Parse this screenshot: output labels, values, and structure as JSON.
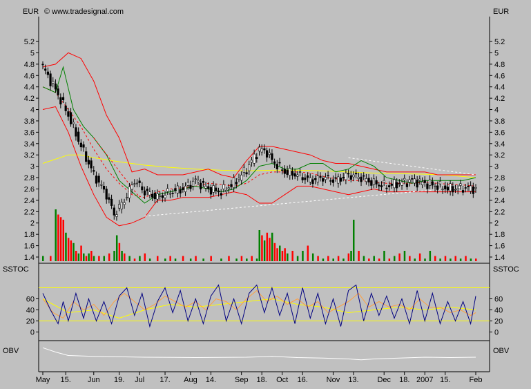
{
  "header": {
    "left_currency": "EUR",
    "copyright": "© www.tradesignal.com",
    "right_currency": "EUR"
  },
  "panel_labels": {
    "sstoc_left": "SSTOC",
    "sstoc_right": "SSTOC",
    "obv_left": "OBV",
    "obv_right": "OBV"
  },
  "colors": {
    "background": "#c0c0c0",
    "candle": "#000000",
    "bollinger_bands": "#ff0000",
    "bollinger_mid": "#ff0000",
    "green_ma": "#008000",
    "yellow_ma": "#ffff00",
    "trendline": "#ffffff",
    "volume_up": "#008000",
    "volume_down": "#ff0000",
    "stoch_k": "#000080",
    "stoch_d": "#ffa040",
    "stoch_signal": "#ffff00",
    "stoch_levels": "#ffff00",
    "obv_line": "#ffffff"
  },
  "chart_data": {
    "type": "line",
    "price_axis": {
      "ticks": [
        1.4,
        1.6,
        1.8,
        2,
        2.2,
        2.4,
        2.6,
        2.8,
        3,
        3.2,
        3.4,
        3.6,
        3.8,
        4,
        4.2,
        4.4,
        4.6,
        4.8,
        5,
        5.2
      ],
      "labels": [
        "1.4",
        "1.6",
        "1.8",
        "2",
        "2.2",
        "2.4",
        "2.6",
        "2.8",
        "3",
        "3.2",
        "3.4",
        "3.6",
        "3.8",
        "4",
        "4.2",
        "4.4",
        "4.6",
        "4.8",
        "5",
        "5.2"
      ]
    },
    "sstoc_axis": {
      "ticks": [
        0,
        20,
        40,
        60
      ],
      "labels": [
        "0",
        "20",
        "40",
        "60"
      ]
    },
    "x_axis": {
      "labels": [
        "May",
        "15.",
        "Jun",
        "19.",
        "Jul",
        "17.",
        "Aug",
        "14.",
        "Sep",
        "18.",
        "Oct",
        "16.",
        "Nov",
        "13.",
        "Dec",
        "18.",
        "2007",
        "15.",
        "Feb"
      ],
      "index": [
        0,
        9,
        20,
        30,
        38,
        48,
        58,
        66,
        78,
        86,
        94,
        102,
        114,
        122,
        134,
        142,
        150,
        158,
        170
      ]
    },
    "series": [
      {
        "key": "close",
        "index": [
          0,
          5,
          10,
          15,
          20,
          25,
          28,
          32,
          36,
          40,
          45,
          50,
          55,
          60,
          65,
          70,
          75,
          80,
          85,
          88,
          90,
          95,
          100,
          105,
          110,
          115,
          120,
          125,
          130,
          135,
          140,
          145,
          150,
          155,
          160,
          165,
          170
        ],
        "values": [
          4.75,
          4.35,
          3.9,
          3.35,
          2.85,
          2.5,
          2.15,
          2.4,
          2.75,
          2.55,
          2.45,
          2.55,
          2.6,
          2.75,
          2.6,
          2.55,
          2.7,
          2.95,
          3.3,
          3.25,
          3.1,
          2.9,
          2.85,
          2.75,
          2.8,
          2.75,
          2.85,
          2.8,
          2.7,
          2.65,
          2.7,
          2.75,
          2.7,
          2.65,
          2.6,
          2.62,
          2.6
        ]
      },
      {
        "key": "bollinger_upper",
        "index": [
          0,
          5,
          10,
          15,
          20,
          25,
          30,
          35,
          40,
          45,
          50,
          55,
          60,
          65,
          70,
          75,
          80,
          85,
          90,
          95,
          100,
          105,
          110,
          115,
          120,
          125,
          130,
          135,
          140,
          145,
          150,
          155,
          160,
          165,
          170
        ],
        "values": [
          4.75,
          4.8,
          5.0,
          4.9,
          4.5,
          3.9,
          3.5,
          2.9,
          2.95,
          2.85,
          2.85,
          2.85,
          2.9,
          2.95,
          2.85,
          2.8,
          3.1,
          3.35,
          3.35,
          3.3,
          3.25,
          3.2,
          3.1,
          3.05,
          3.05,
          3.0,
          2.95,
          2.9,
          2.9,
          2.9,
          2.9,
          2.85,
          2.85,
          2.85,
          2.85
        ]
      },
      {
        "key": "bollinger_lower",
        "index": [
          0,
          5,
          10,
          15,
          20,
          25,
          30,
          35,
          40,
          45,
          50,
          55,
          60,
          65,
          70,
          75,
          80,
          85,
          90,
          95,
          100,
          105,
          110,
          115,
          120,
          125,
          130,
          135,
          140,
          145,
          150,
          155,
          160,
          165,
          170
        ],
        "values": [
          4.0,
          4.05,
          3.6,
          3.0,
          2.5,
          2.1,
          1.95,
          2.0,
          2.1,
          2.4,
          2.4,
          2.45,
          2.45,
          2.45,
          2.5,
          2.55,
          2.5,
          2.35,
          2.35,
          2.5,
          2.65,
          2.65,
          2.6,
          2.55,
          2.5,
          2.55,
          2.6,
          2.55,
          2.55,
          2.55,
          2.55,
          2.55,
          2.55,
          2.55,
          2.55
        ]
      },
      {
        "key": "bollinger_middle",
        "index": [
          0,
          5,
          10,
          15,
          20,
          25,
          30,
          35,
          40,
          45,
          50,
          55,
          60,
          65,
          70,
          75,
          80,
          85,
          90,
          95,
          100,
          105,
          110,
          115,
          120,
          125,
          130,
          135,
          140,
          145,
          150,
          155,
          160,
          165,
          170
        ],
        "values": [
          4.4,
          4.3,
          4.0,
          3.7,
          3.3,
          2.95,
          2.7,
          2.5,
          2.45,
          2.55,
          2.6,
          2.62,
          2.65,
          2.7,
          2.68,
          2.65,
          2.7,
          2.85,
          2.9,
          2.9,
          2.9,
          2.88,
          2.82,
          2.78,
          2.75,
          2.75,
          2.72,
          2.7,
          2.7,
          2.7,
          2.72,
          2.7,
          2.68,
          2.67,
          2.65
        ]
      },
      {
        "key": "green_ma",
        "index": [
          0,
          5,
          8,
          12,
          16,
          20,
          25,
          30,
          35,
          40,
          45,
          50,
          55,
          60,
          65,
          70,
          75,
          80,
          85,
          90,
          95,
          100,
          105,
          110,
          115,
          120,
          125,
          130,
          135,
          140,
          145,
          150,
          155,
          160,
          165,
          170
        ],
        "values": [
          4.4,
          4.3,
          4.75,
          4.0,
          3.7,
          3.5,
          3.2,
          2.75,
          2.55,
          2.35,
          2.5,
          2.55,
          2.6,
          2.65,
          2.6,
          2.55,
          2.6,
          2.75,
          3.0,
          3.05,
          2.95,
          2.95,
          3.05,
          3.05,
          2.9,
          2.95,
          3.1,
          3.0,
          2.8,
          2.75,
          2.7,
          2.75,
          2.75,
          2.75,
          2.75,
          2.8
        ]
      },
      {
        "key": "yellow_ma",
        "index": [
          0,
          10,
          15,
          20,
          30,
          40,
          50,
          60,
          70,
          80,
          90,
          100,
          110,
          120,
          130,
          140,
          150,
          160,
          170
        ],
        "values": [
          3.05,
          3.2,
          3.2,
          3.15,
          3.08,
          3.02,
          2.98,
          2.95,
          2.93,
          2.92,
          2.93,
          2.93,
          2.92,
          2.9,
          2.88,
          2.87,
          2.86,
          2.84,
          2.8
        ]
      },
      {
        "key": "volume",
        "index": [
          0,
          3,
          5,
          6,
          7,
          8,
          9,
          10,
          11,
          12,
          13,
          14,
          15,
          16,
          17,
          18,
          19,
          20,
          22,
          24,
          26,
          28,
          29,
          30,
          31,
          32,
          34,
          36,
          38,
          40,
          42,
          45,
          48,
          50,
          52,
          55,
          58,
          60,
          63,
          66,
          70,
          73,
          76,
          78,
          80,
          82,
          84,
          85,
          86,
          87,
          88,
          89,
          90,
          91,
          92,
          93,
          94,
          95,
          96,
          98,
          100,
          102,
          104,
          106,
          108,
          110,
          112,
          114,
          116,
          118,
          120,
          121,
          122,
          124,
          126,
          128,
          130,
          132,
          134,
          136,
          138,
          140,
          142,
          144,
          146,
          148,
          150,
          152,
          154,
          156,
          158,
          160,
          162,
          164,
          166,
          168,
          170
        ],
        "values": [
          0.1,
          0.1,
          1.0,
          0.9,
          0.85,
          0.8,
          0.55,
          0.45,
          0.4,
          0.35,
          0.2,
          0.15,
          0.3,
          0.15,
          0.1,
          0.15,
          0.2,
          0.1,
          0.1,
          0.1,
          0.15,
          0.2,
          0.5,
          0.35,
          0.2,
          0.15,
          0.1,
          0.05,
          0.1,
          0.15,
          0.05,
          0.1,
          0.05,
          0.1,
          0.05,
          0.1,
          0.05,
          0.1,
          0.05,
          0.1,
          0.05,
          0.1,
          0.05,
          0.1,
          0.05,
          0.1,
          0.05,
          0.6,
          0.5,
          0.4,
          0.55,
          0.45,
          0.55,
          0.35,
          0.25,
          0.3,
          0.2,
          0.25,
          0.15,
          0.2,
          0.1,
          0.2,
          0.3,
          0.15,
          0.1,
          0.05,
          0.1,
          0.05,
          0.1,
          0.05,
          0.15,
          0.2,
          0.8,
          0.2,
          0.1,
          0.05,
          0.1,
          0.05,
          0.2,
          0.05,
          0.1,
          0.15,
          0.2,
          0.1,
          0.05,
          0.15,
          0.05,
          0.2,
          0.1,
          0.05,
          0.1,
          0.05,
          0.1,
          0.05,
          0.1,
          0.05,
          0.05
        ],
        "up": [
          true,
          false,
          true,
          false,
          false,
          false,
          true,
          false,
          false,
          true,
          false,
          true,
          false,
          true,
          false,
          true,
          false,
          true,
          false,
          true,
          false,
          true,
          true,
          false,
          true,
          false,
          true,
          false,
          true,
          false,
          true,
          false,
          true,
          false,
          true,
          false,
          true,
          false,
          true,
          false,
          true,
          false,
          true,
          false,
          true,
          false,
          true,
          true,
          false,
          true,
          false,
          false,
          true,
          false,
          false,
          true,
          false,
          false,
          true,
          false,
          true,
          true,
          false,
          true,
          false,
          true,
          false,
          true,
          false,
          true,
          false,
          true,
          true,
          false,
          true,
          false,
          true,
          false,
          true,
          false,
          true,
          false,
          true,
          false,
          true,
          false,
          true,
          true,
          false,
          true,
          false,
          true,
          false,
          true,
          false,
          true,
          false
        ]
      },
      {
        "key": "stoch_k",
        "index": [
          0,
          3,
          6,
          8,
          10,
          13,
          16,
          18,
          21,
          24,
          27,
          30,
          33,
          36,
          39,
          42,
          45,
          48,
          51,
          54,
          57,
          60,
          63,
          66,
          69,
          72,
          75,
          78,
          81,
          84,
          87,
          90,
          93,
          96,
          99,
          102,
          105,
          108,
          111,
          114,
          117,
          120,
          123,
          126,
          129,
          132,
          135,
          138,
          141,
          144,
          147,
          150,
          153,
          156,
          159,
          162,
          165,
          168,
          170
        ],
        "values": [
          70,
          40,
          15,
          55,
          20,
          70,
          25,
          60,
          20,
          55,
          15,
          65,
          80,
          30,
          70,
          10,
          55,
          80,
          35,
          75,
          20,
          60,
          15,
          65,
          85,
          20,
          60,
          15,
          70,
          85,
          35,
          80,
          30,
          70,
          15,
          80,
          25,
          70,
          15,
          60,
          10,
          75,
          85,
          20,
          70,
          30,
          65,
          25,
          60,
          15,
          75,
          20,
          70,
          15,
          55,
          20,
          55,
          15,
          65
        ]
      },
      {
        "key": "stoch_d",
        "index": [
          0,
          4,
          8,
          12,
          16,
          20,
          24,
          28,
          32,
          36,
          40,
          44,
          48,
          52,
          56,
          60,
          64,
          68,
          72,
          76,
          80,
          84,
          88,
          92,
          96,
          100,
          104,
          108,
          112,
          116,
          120,
          124,
          128,
          132,
          136,
          140,
          144,
          148,
          152,
          156,
          160,
          164,
          168,
          170
        ],
        "values": [
          60,
          35,
          25,
          55,
          40,
          50,
          30,
          55,
          70,
          55,
          40,
          50,
          65,
          55,
          45,
          55,
          40,
          60,
          55,
          40,
          60,
          75,
          55,
          65,
          50,
          60,
          45,
          55,
          35,
          45,
          55,
          70,
          45,
          55,
          45,
          50,
          40,
          60,
          45,
          45,
          35,
          40,
          30,
          35
        ]
      },
      {
        "key": "stoch_signal",
        "index": [
          0,
          10,
          20,
          30,
          40,
          50,
          60,
          70,
          80,
          90,
          100,
          110,
          120,
          130,
          140,
          150,
          160,
          170
        ],
        "values": [
          60,
          35,
          40,
          25,
          40,
          50,
          45,
          50,
          55,
          60,
          50,
          45,
          35,
          40,
          45,
          40,
          45,
          40
        ]
      },
      {
        "key": "stoch_levels",
        "values": [
          80,
          20
        ]
      },
      {
        "key": "obv",
        "index": [
          0,
          5,
          10,
          20,
          40,
          60,
          80,
          90,
          100,
          110,
          120,
          125,
          130,
          140,
          150,
          160,
          170
        ],
        "values": [
          0.95,
          0.7,
          0.5,
          0.45,
          0.4,
          0.38,
          0.4,
          0.45,
          0.38,
          0.35,
          0.3,
          0.25,
          0.3,
          0.35,
          0.4,
          0.38,
          0.4
        ]
      },
      {
        "key": "trend_upper",
        "index": [
          120,
          170
        ],
        "values": [
          3.15,
          2.85
        ]
      },
      {
        "key": "trend_lower",
        "index": [
          40,
          170
        ],
        "values": [
          2.12,
          2.65
        ]
      },
      {
        "key": "trend_down",
        "index": [
          20,
          38
        ],
        "values": [
          3.5,
          2.45
        ]
      }
    ]
  }
}
